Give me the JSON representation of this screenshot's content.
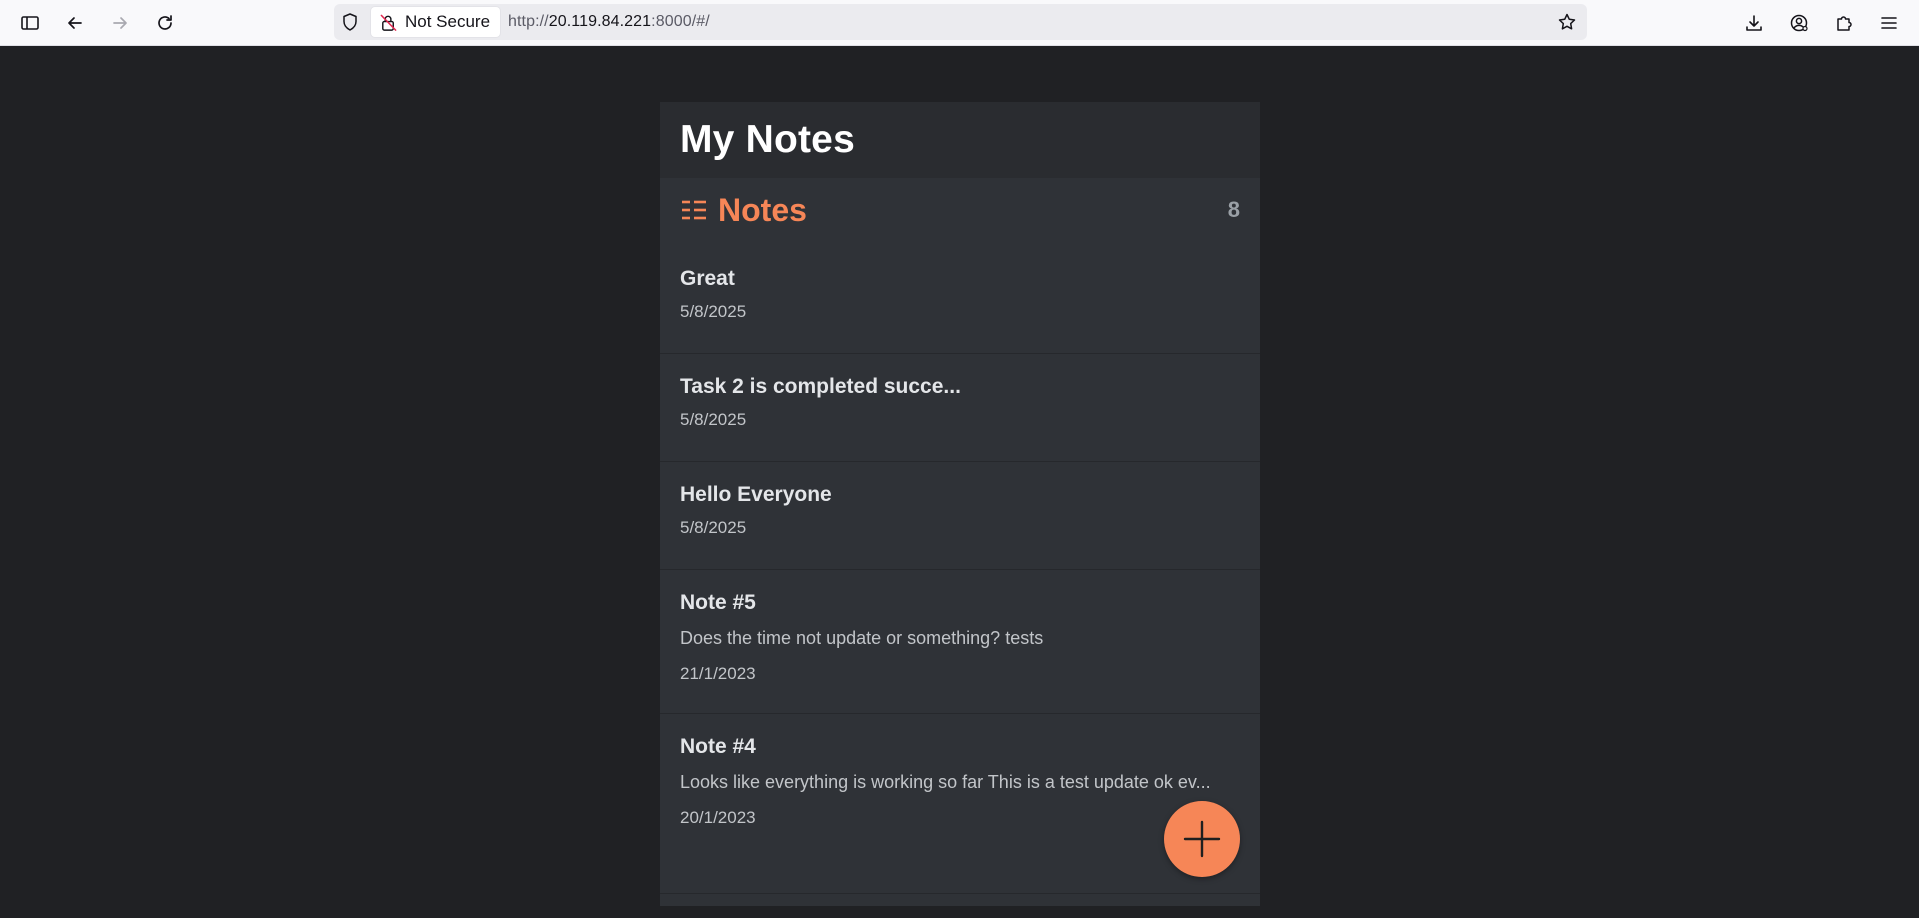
{
  "browser": {
    "security_label": "Not Secure",
    "url_scheme": "http://",
    "url_host": "20.119.84.221",
    "url_rest": ":8000/#/"
  },
  "app": {
    "title": "My Notes",
    "list_title": "Notes",
    "count": "8"
  },
  "notes": [
    {
      "title": "Great",
      "body": "",
      "date": "5/8/2025"
    },
    {
      "title": "Task 2 is completed succe...",
      "body": "",
      "date": "5/8/2025"
    },
    {
      "title": "Hello Everyone",
      "body": "",
      "date": "5/8/2025"
    },
    {
      "title": "Note #5",
      "body": "Does the time not update or something? tests",
      "date": "21/1/2023"
    },
    {
      "title": "Note #4",
      "body": "Looks like everything is working so far This is a test update ok ev...",
      "date": "20/1/2023"
    }
  ],
  "colors": {
    "accent": "#f68657",
    "background": "#202124",
    "panel": "#2f3237"
  },
  "icons": {
    "list": "list-icon",
    "add": "plus-icon"
  }
}
